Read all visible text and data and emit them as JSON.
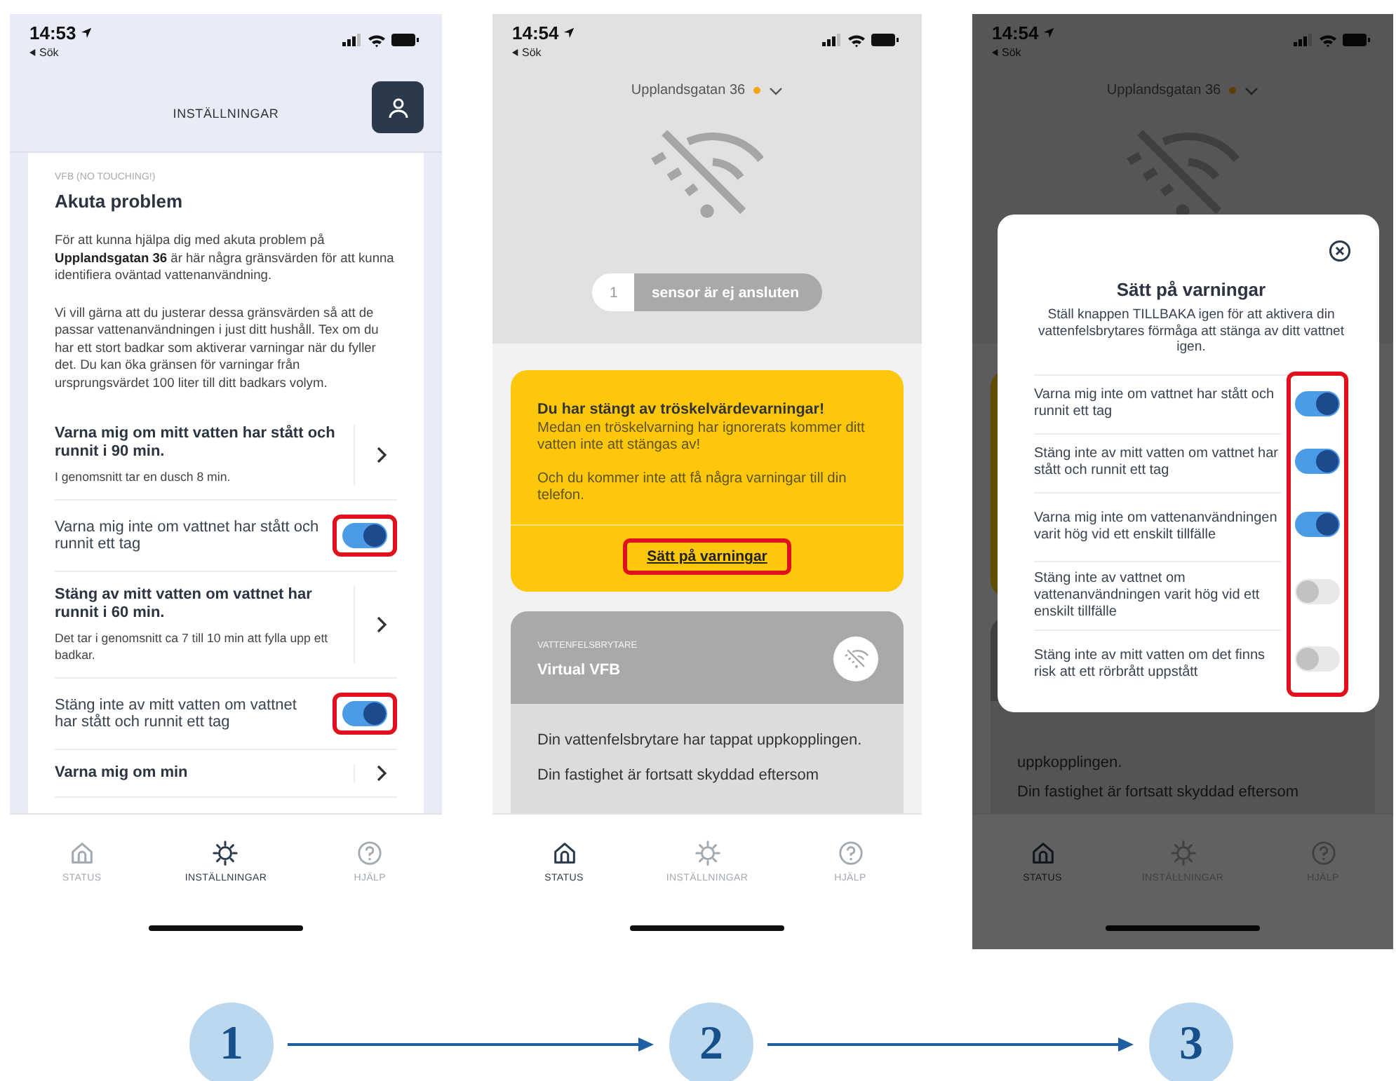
{
  "screens": [
    {
      "kind": "settings",
      "status_bar": {
        "time": "14:53",
        "back": "Sök"
      },
      "title": "INSTÄLLNINGAR",
      "card": {
        "overline": "VFB (NO TOUCHING!)",
        "heading": "Akuta problem",
        "paragraphs": [
          "För att kunna hjälpa dig med akuta problem på **Upplandsgatan 36** är här några gränsvärden för att kunna identifiera oväntad vattenanvändning.",
          "Vi vill gärna att du justerar dessa gränsvärden så att de passar vattenanvändningen i just ditt hushåll. Tex om du har ett stort badkar som aktiverar varningar när du fyller det. Du kan öka gränsen för varningar från ursprungsvärdet 100 liter till ditt badkars volym."
        ]
      },
      "items": [
        {
          "kind": "link",
          "title": "Varna mig om mitt vatten har stått och runnit i 90 min.",
          "subtitle": "I genomsnitt tar en dusch 8 min."
        },
        {
          "kind": "toggle",
          "label": "Varna mig inte om vattnet har stått och runnit ett tag",
          "on": true,
          "highlighted": true
        },
        {
          "kind": "link",
          "title": "Stäng av mitt vatten om vattnet har runnit i 60 min.",
          "subtitle": "Det tar i genomsnitt ca 7 till 10 min att fylla upp ett badkar."
        },
        {
          "kind": "toggle",
          "label": "Stäng inte av mitt vatten om vattnet har stått och runnit ett tag",
          "on": true,
          "highlighted": true
        },
        {
          "kind": "link",
          "title": "Varna mig om min"
        }
      ],
      "tabs": [
        {
          "kind": "home",
          "label": "STATUS",
          "selected": false
        },
        {
          "kind": "settings",
          "label": "INSTÄLLNINGAR",
          "selected": true
        },
        {
          "kind": "help",
          "label": "HJÄLP",
          "selected": false
        }
      ]
    },
    {
      "kind": "status",
      "status_bar": {
        "time": "14:54",
        "back": "Sök"
      },
      "address": "Upplandsgatan 36",
      "sensor": {
        "count": "1",
        "text": "sensor är ej ansluten"
      },
      "alert": {
        "title": "Du har stängt av tröskelvärdevarningar!",
        "paragraphs": [
          "Medan en tröskelvarning har ignorerats kommer ditt vatten inte att stängas av!",
          "Och du kommer inte att få några varningar till din telefon."
        ],
        "action": "Sätt på varningar",
        "action_highlighted": true
      },
      "device": {
        "overline": "VATTENFELSBRYTARE",
        "name": "Virtual VFB",
        "paragraphs": [
          "Din vattenfelsbrytare har tappat uppkopplingen.",
          "Din fastighet är fortsatt skyddad eftersom"
        ]
      },
      "tabs": [
        {
          "kind": "home",
          "label": "STATUS",
          "selected": true
        },
        {
          "kind": "settings",
          "label": "INSTÄLLNINGAR",
          "selected": false
        },
        {
          "kind": "help",
          "label": "HJÄLP",
          "selected": false
        }
      ]
    },
    {
      "kind": "modal",
      "status_bar": {
        "time": "14:54",
        "back": "Sök"
      },
      "address": "Upplandsgatan 36",
      "device": {
        "paragraphs": [
          "uppkopplingen.",
          "Din fastighet är fortsatt skyddad eftersom"
        ]
      },
      "modal": {
        "title": "Sätt på varningar",
        "text": "Ställ knappen TILLBAKA igen för att aktivera din vattenfelsbrytares förmåga att stänga av ditt vattnet igen.",
        "toggles_highlighted": true,
        "toggles": [
          {
            "label": "Varna mig inte om vattnet har stått och runnit ett tag",
            "on": true
          },
          {
            "label": "Stäng inte av mitt vatten om vattnet har stått och runnit ett tag",
            "on": true
          },
          {
            "label": "Varna mig inte om vattenanvändningen varit hög vid ett enskilt tillfälle",
            "on": true
          },
          {
            "label": "Stäng inte av vattnet om vattenanvändningen varit hög vid ett enskilt tillfälle",
            "on": false
          },
          {
            "label": "Stäng inte av mitt vatten om det finns risk att ett rörbrått uppstått",
            "on": false
          }
        ]
      },
      "tabs": [
        {
          "kind": "home",
          "label": "STATUS",
          "selected": true
        },
        {
          "kind": "settings",
          "label": "INSTÄLLNINGAR",
          "selected": false
        },
        {
          "kind": "help",
          "label": "HJÄLP",
          "selected": false
        }
      ]
    }
  ],
  "steps": [
    "1",
    "2",
    "3"
  ]
}
